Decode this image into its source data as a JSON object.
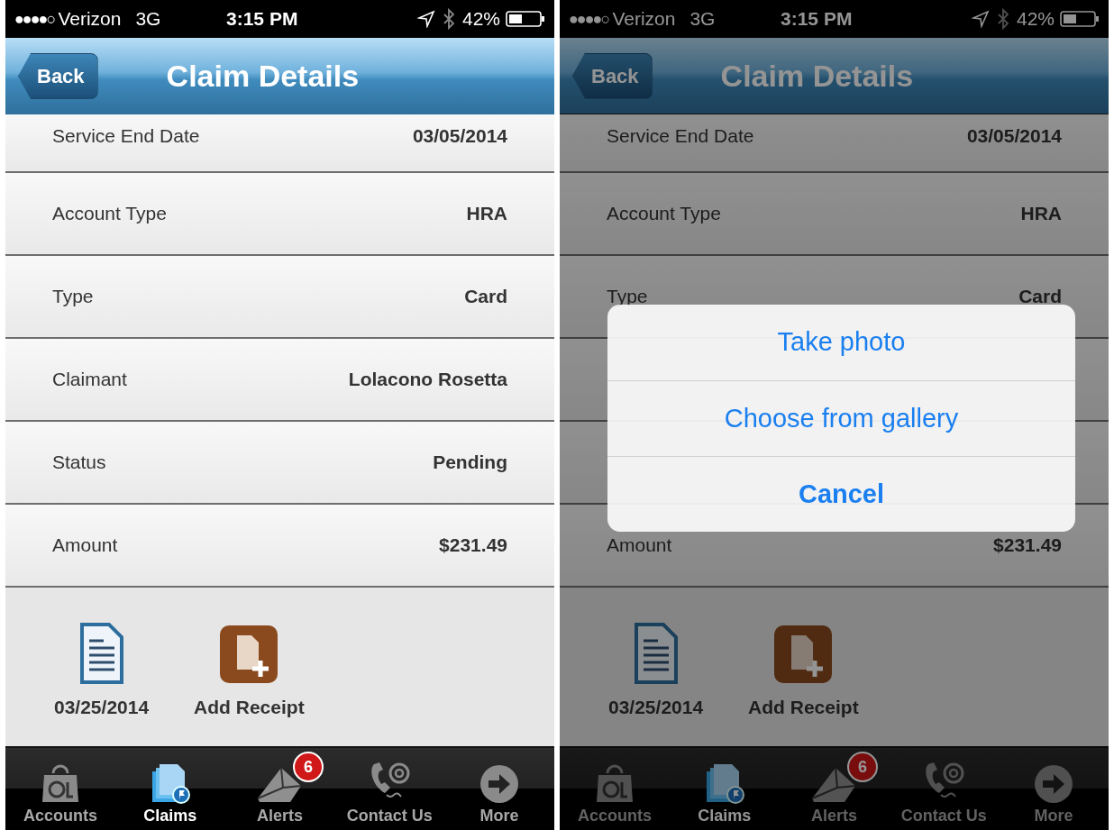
{
  "screens": [
    {
      "status_bar": {
        "signal": "●●●●○",
        "carrier": "Verizon",
        "network": "3G",
        "time": "3:15 PM",
        "battery": "42%"
      },
      "nav": {
        "back": "Back",
        "title": "Claim Details"
      },
      "dimmed": false,
      "rows": [
        {
          "label": "Service End Date",
          "value": "03/05/2014"
        },
        {
          "label": "Account Type",
          "value": "HRA"
        },
        {
          "label": "Type",
          "value": "Card"
        },
        {
          "label": "Claimant",
          "value": "Lolacono Rosetta"
        },
        {
          "label": "Status",
          "value": "Pending"
        },
        {
          "label": "Amount",
          "value": "$231.49"
        }
      ],
      "attachments": [
        {
          "kind": "document",
          "label": "03/25/2014"
        },
        {
          "kind": "add",
          "label": "Add Receipt"
        }
      ],
      "tabs": [
        {
          "kind": "accounts",
          "label": "Accounts",
          "selected": false
        },
        {
          "kind": "claims",
          "label": "Claims",
          "selected": true
        },
        {
          "kind": "alerts",
          "label": "Alerts",
          "selected": false,
          "badge": "6"
        },
        {
          "kind": "contact",
          "label": "Contact Us",
          "selected": false
        },
        {
          "kind": "more",
          "label": "More",
          "selected": false
        }
      ]
    },
    {
      "status_bar": {
        "signal": "●●●●○",
        "carrier": "Verizon",
        "network": "3G",
        "time": "3:15 PM",
        "battery": "42%"
      },
      "nav": {
        "back": "Back",
        "title": "Claim Details"
      },
      "dimmed": true,
      "rows": [
        {
          "label": "Service End Date",
          "value": "03/05/2014"
        },
        {
          "label": "Account Type",
          "value": "HRA"
        },
        {
          "label": "Type",
          "value": "Card"
        },
        {},
        {},
        {
          "label": "Amount",
          "value": "$231.49"
        }
      ],
      "attachments": [
        {
          "kind": "document",
          "label": "03/25/2014"
        },
        {
          "kind": "add",
          "label": "Add Receipt"
        }
      ],
      "tabs": [
        {
          "kind": "accounts",
          "label": "Accounts",
          "selected": false
        },
        {
          "kind": "claims",
          "label": "Claims",
          "selected": true
        },
        {
          "kind": "alerts",
          "label": "Alerts",
          "selected": false,
          "badge": "6"
        },
        {
          "kind": "contact",
          "label": "Contact Us",
          "selected": false
        },
        {
          "kind": "more",
          "label": "More",
          "selected": false
        }
      ],
      "sheet": {
        "options": [
          "Take photo",
          "Choose from gallery"
        ],
        "cancel": "Cancel"
      }
    }
  ]
}
